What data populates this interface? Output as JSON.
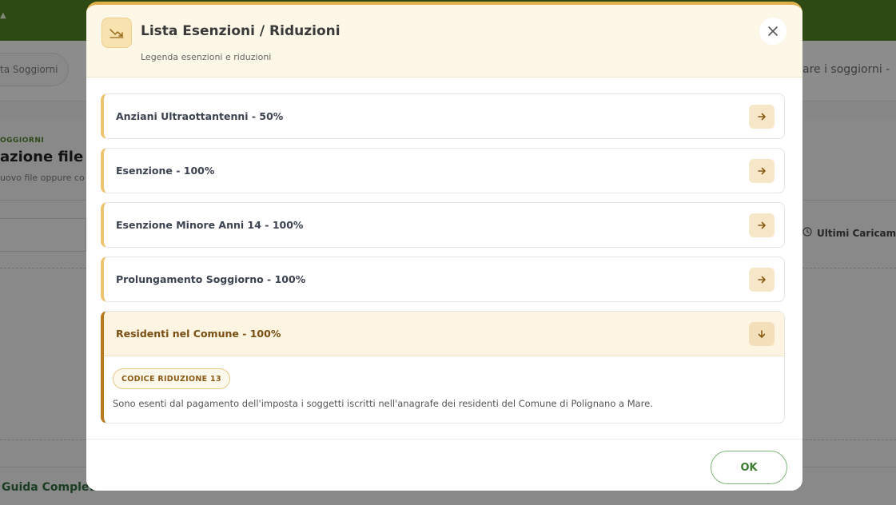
{
  "background": {
    "nav_pill_label": "ta Soggiorni",
    "nav_right_label": "are i soggiorni  -",
    "kicker": "OGGIORNI",
    "title": "azione file c",
    "subtitle": "uovo file oppure co",
    "ultimi_label": "Ultimi Caricame",
    "guida_label": "Guida Completa"
  },
  "modal": {
    "title": "Lista Esenzioni / Riduzioni",
    "subtitle": "Legenda esenzioni e riduzioni",
    "items": [
      {
        "label": "Anziani Ultraottantenni - 50%"
      },
      {
        "label": "Esenzione - 100%"
      },
      {
        "label": "Esenzione Minore Anni 14 - 100%"
      },
      {
        "label": "Prolungamento Soggiorno - 100%"
      },
      {
        "label": "Residenti nel Comune - 100%",
        "code_badge": "CODICE RIDUZIONE 13",
        "description": "Sono esenti dal pagamento dell'imposta i soggetti iscritti nell'anagrafe dei residenti del Comune di Polignano a Mare."
      }
    ],
    "ok_label": "OK"
  },
  "colors": {
    "topbar": "#4e7f24",
    "accent": "#e2b04a",
    "item_border": "#efc46e",
    "open_border": "#b8791f",
    "ok_text": "#3c7a30"
  },
  "icons": {
    "header": "trending-down-icon",
    "close": "close-icon",
    "item_collapsed": "arrow-right-icon",
    "item_expanded": "arrow-down-icon",
    "clock": "clock-icon"
  }
}
